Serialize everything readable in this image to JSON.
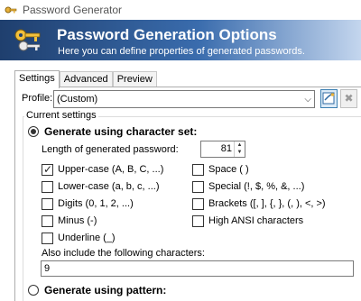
{
  "window": {
    "title": "Password Generator",
    "app_icon": "key-icon"
  },
  "banner": {
    "title": "Password Generation Options",
    "subtitle": "Here you can define properties of generated passwords.",
    "icon": "keys-icon"
  },
  "tabs": [
    {
      "label": "Settings",
      "active": true
    },
    {
      "label": "Advanced",
      "active": false
    },
    {
      "label": "Preview",
      "active": false
    }
  ],
  "profile": {
    "label": "Profile:",
    "value": "(Custom)",
    "save_icon": "save-profile-icon",
    "delete_icon": "delete-profile-icon"
  },
  "current_settings": {
    "label": "Current settings",
    "charset_radio": {
      "label": "Generate using character set:",
      "checked": true
    },
    "length_label": "Length of generated password:",
    "length_value": "81",
    "checkboxes": [
      {
        "label": "Upper-case (A, B, C, ...)",
        "checked": true
      },
      {
        "label": "Lower-case (a, b, c, ...)",
        "checked": false
      },
      {
        "label": "Digits (0, 1, 2, ...)",
        "checked": false
      },
      {
        "label": "Minus (-)",
        "checked": false
      },
      {
        "label": "Underline (_)",
        "checked": false
      },
      {
        "label": "Space ( )",
        "checked": false
      },
      {
        "label": "Special (!, $, %, &, ...)",
        "checked": false
      },
      {
        "label": "Brackets ([, ], {, }, (, ), <, >)",
        "checked": false
      },
      {
        "label": "High ANSI characters",
        "checked": false
      }
    ],
    "also_include_label": "Also include the following characters:",
    "also_include_value": "9",
    "pattern_radio": {
      "label": "Generate using pattern:",
      "checked": false
    }
  }
}
